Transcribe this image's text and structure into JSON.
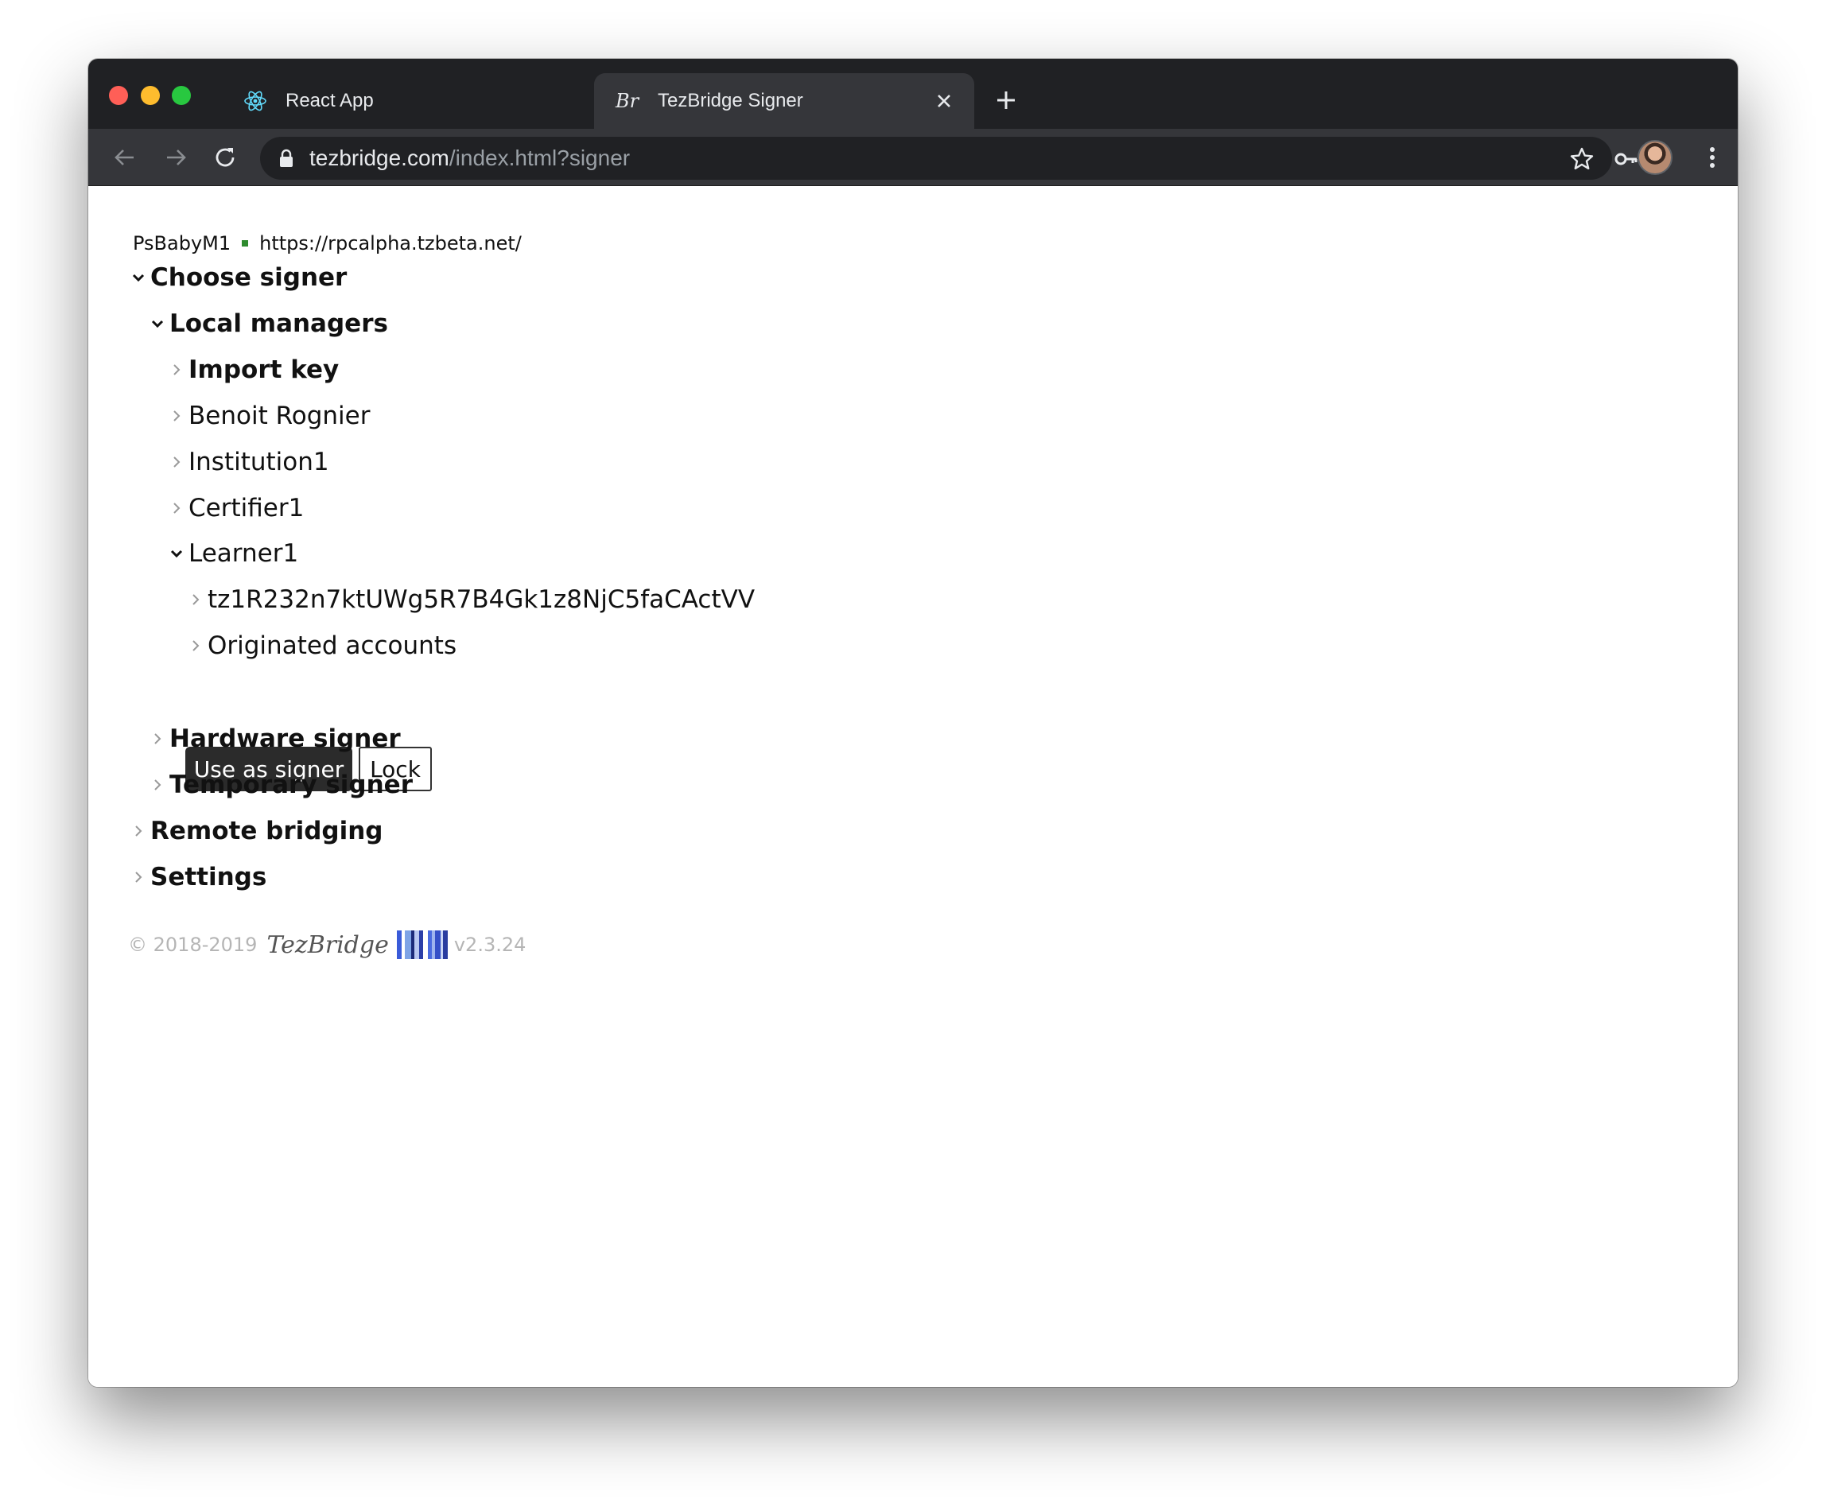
{
  "browser": {
    "tabs": [
      {
        "title": "React App",
        "icon": "react-icon"
      },
      {
        "title": "TezBridge Signer",
        "icon": "tezbridge-icon",
        "active": true
      }
    ],
    "address": {
      "host": "tezbridge.com",
      "path": "/index.html?signer"
    }
  },
  "status": {
    "protocol": "PsBabyM1",
    "node_url": "https://rpcalpha.tzbeta.net/",
    "connection_color": "#2e8b2e"
  },
  "tree": {
    "choose_signer": "Choose signer",
    "local_managers": "Local managers",
    "import_key": "Import key",
    "benoit": "Benoit Rognier",
    "institution": "Institution1",
    "certifier": "Certifier1",
    "learner": "Learner1",
    "address": "tz1R232n7ktUWg5R7B4Gk1z8NjC5faCActVV",
    "originated": "Originated accounts",
    "hardware": "Hardware signer",
    "temporary": "Temporary signer",
    "remote": "Remote bridging",
    "settings": "Settings"
  },
  "actions": {
    "use_as_signer": "Use as signer",
    "lock": "Lock"
  },
  "footer": {
    "copyright": "© 2018-2019",
    "brand": "TezBridge",
    "version": "v2.3.24"
  }
}
